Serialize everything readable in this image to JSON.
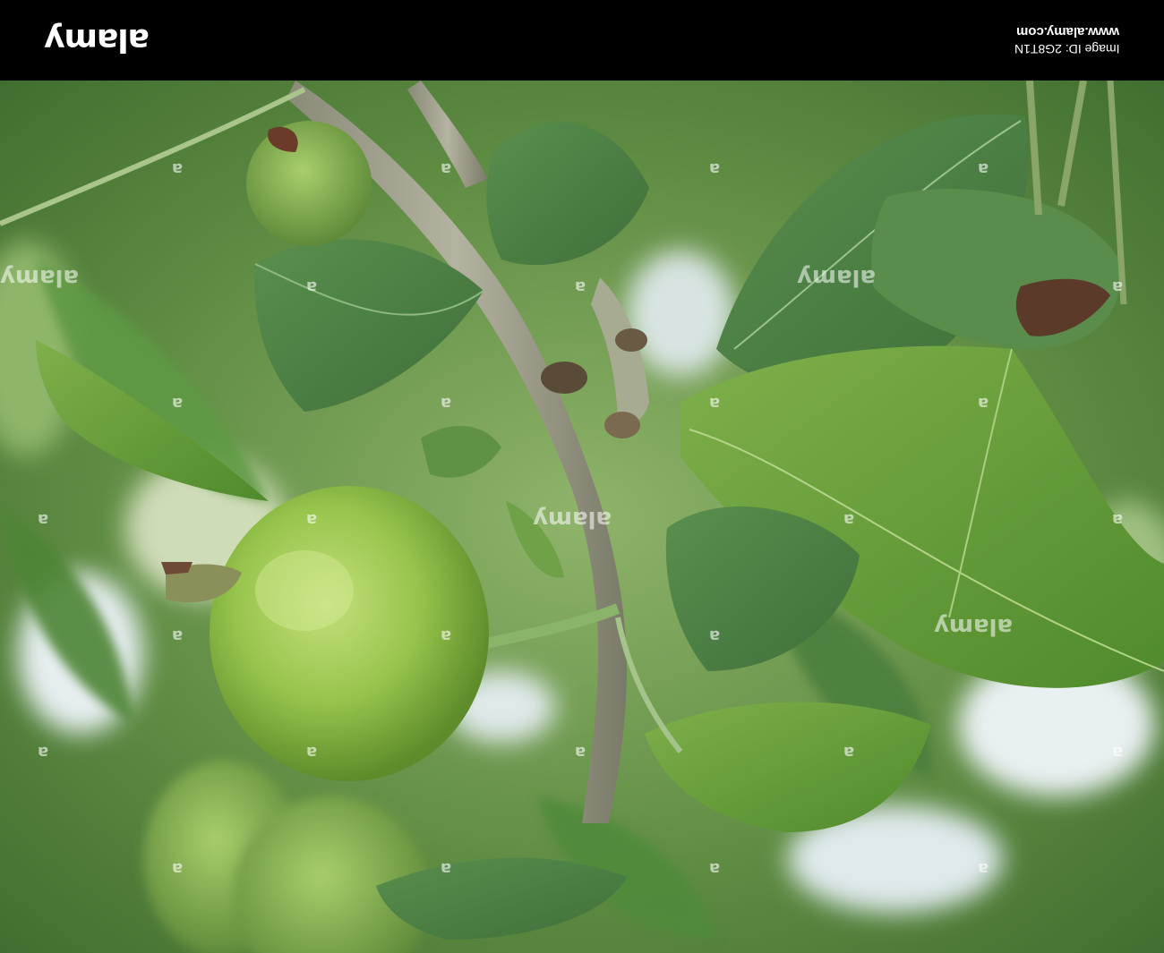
{
  "banner": {
    "logo": "alamy",
    "url": "www.alamy.com",
    "image_id": "Image ID: 2G8T1N"
  },
  "photo": {
    "watermark_large": "alamy",
    "watermark_small": "a"
  }
}
